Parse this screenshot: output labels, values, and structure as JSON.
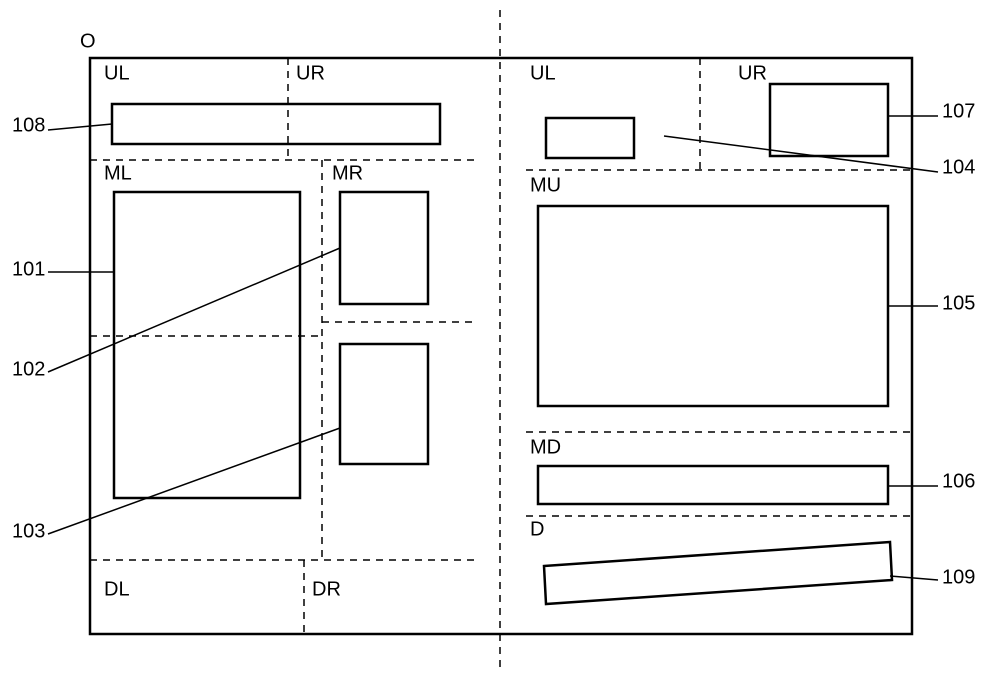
{
  "origin_label": "O",
  "left": {
    "ul": "UL",
    "ur": "UR",
    "ml": "ML",
    "mr": "MR",
    "dl": "DL",
    "dr": "DR"
  },
  "right": {
    "ul": "UL",
    "ur": "UR",
    "mu": "MU",
    "md": "MD",
    "d": "D"
  },
  "callouts": {
    "c101": "101",
    "c102": "102",
    "c103": "103",
    "c104": "104",
    "c105": "105",
    "c106": "106",
    "c107": "107",
    "c108": "108",
    "c109": "109"
  }
}
